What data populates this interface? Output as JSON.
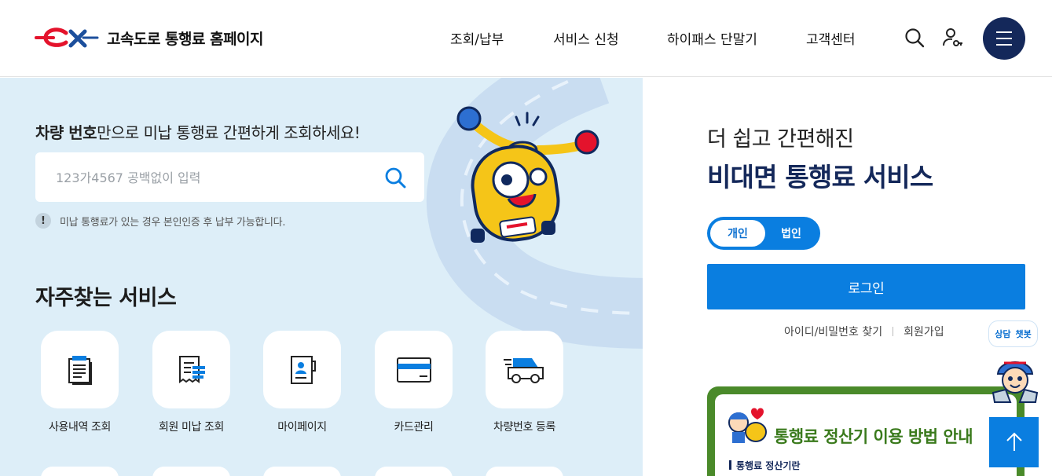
{
  "header": {
    "site_title": "고속도로 통행료 홈페이지",
    "nav": [
      "조회/납부",
      "서비스 신청",
      "하이패스 단말기",
      "고객센터"
    ],
    "icons": [
      "search-icon",
      "user-key-icon",
      "hamburger-menu-icon"
    ]
  },
  "search": {
    "title_bold": "차량 번호",
    "title_rest": "만으로 미납 통행료 간편하게 조회하세요!",
    "placeholder": "123가4567 공백없이 입력",
    "notice_mark": "!",
    "notice": "미납 통행료가 있는 경우 본인인증 후 납부 가능합니다."
  },
  "services": {
    "title": "자주찾는 서비스",
    "items": [
      {
        "label": "사용내역 조회",
        "icon": "document-list-icon"
      },
      {
        "label": "회원 미납 조회",
        "icon": "receipt-icon"
      },
      {
        "label": "마이페이지",
        "icon": "profile-book-icon"
      },
      {
        "label": "카드관리",
        "icon": "card-icon"
      },
      {
        "label": "차량번호 등록",
        "icon": "car-icon"
      }
    ]
  },
  "login_panel": {
    "subtitle": "더 쉽고 간편해진",
    "title": "비대면 통행료 서비스",
    "toggle": {
      "active": "개인",
      "inactive": "법인"
    },
    "login_button": "로그인",
    "find_link": "아이디/비밀번호 찾기",
    "join_link": "회원가입"
  },
  "banner": {
    "title": "통행료 정산기 이용 방법 안내",
    "subtitle": "통행료 정산기란"
  },
  "chatbot": {
    "left": "상담",
    "right": "챗봇"
  },
  "colors": {
    "primary": "#0a7ee0",
    "navy": "#14285a",
    "left_bg": "#ddeef8",
    "banner_green": "#4a8a2a"
  }
}
